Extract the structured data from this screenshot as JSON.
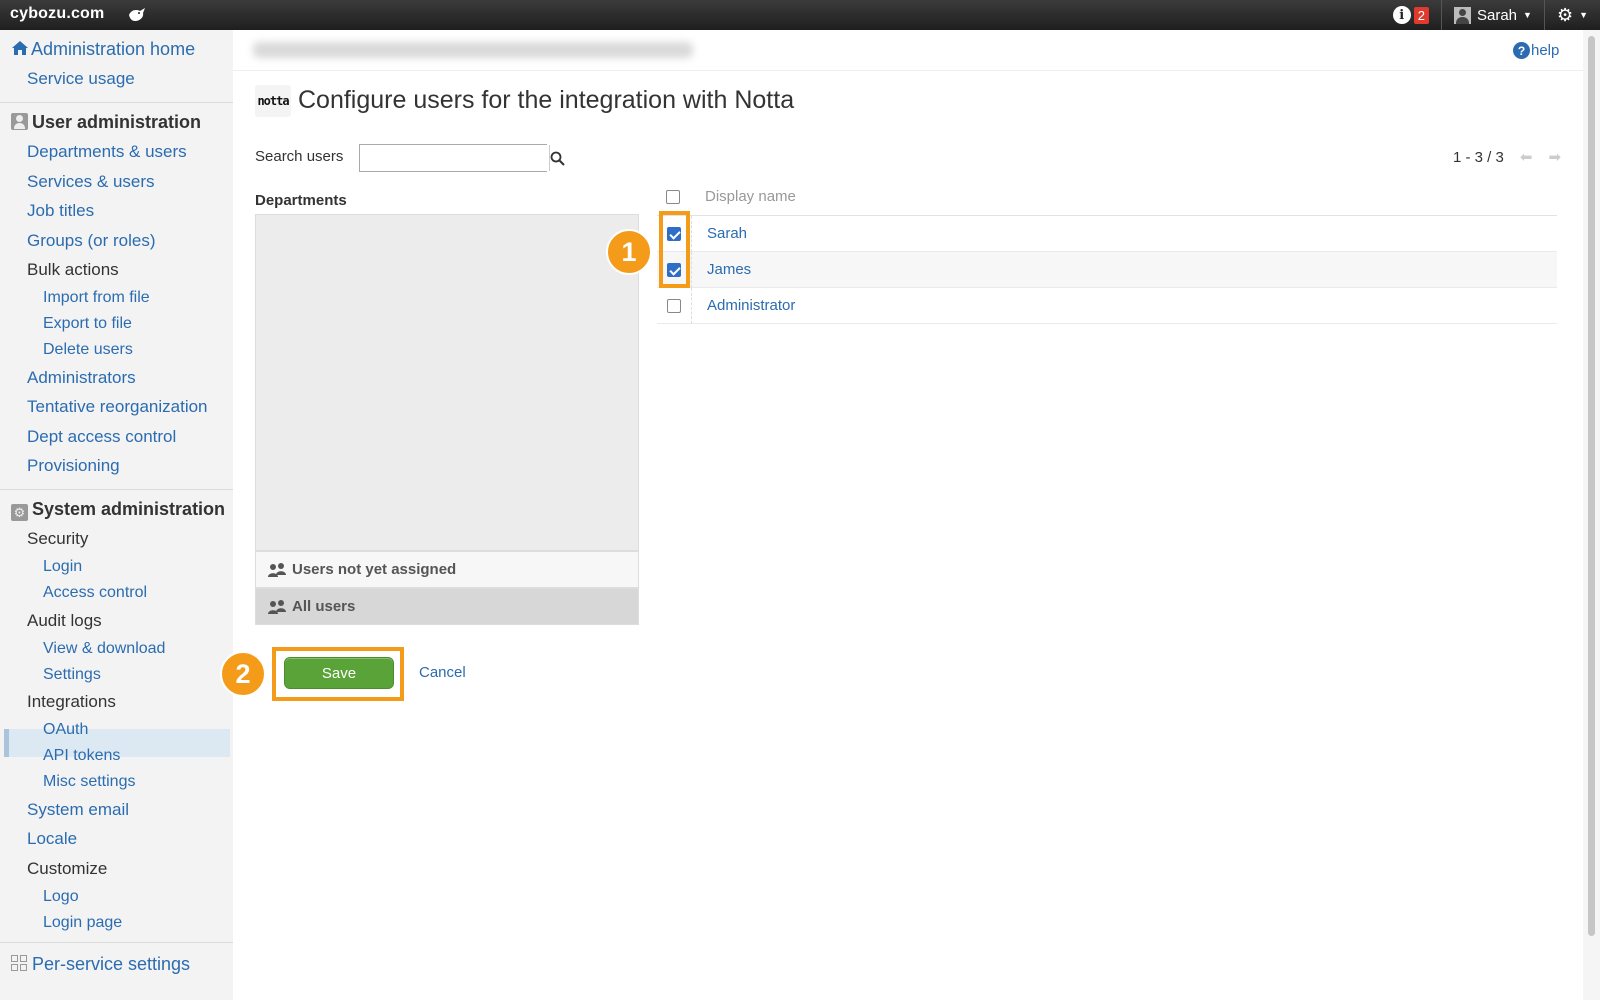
{
  "topbar": {
    "brand": "cybozu.com",
    "notifications_count": "2",
    "user_name": "Sarah"
  },
  "sidebar": {
    "administration_home": "Administration home",
    "service_usage": "Service usage",
    "user_admin": {
      "heading": "User administration",
      "departments_users": "Departments & users",
      "services_users": "Services & users",
      "job_titles": "Job titles",
      "groups_roles": "Groups (or roles)",
      "bulk_actions": "Bulk actions",
      "import_from_file": "Import from file",
      "export_to_file": "Export to file",
      "delete_users": "Delete users",
      "administrators": "Administrators",
      "tentative_reorganization": "Tentative reorganization",
      "dept_access_control": "Dept access control",
      "provisioning": "Provisioning"
    },
    "system_admin": {
      "heading": "System administration",
      "security": "Security",
      "login": "Login",
      "access_control": "Access control",
      "audit_logs": "Audit logs",
      "view_download": "View & download",
      "settings": "Settings",
      "integrations": "Integrations",
      "oauth": "OAuth",
      "api_tokens": "API tokens",
      "misc_settings": "Misc settings",
      "system_email": "System email",
      "locale": "Locale",
      "customize": "Customize",
      "logo": "Logo",
      "login_page": "Login page"
    },
    "per_service_settings": "Per-service settings"
  },
  "main": {
    "help": "help",
    "app_logo_text": "notta",
    "title": "Configure users for the integration with Notta",
    "search_label": "Search users",
    "search_value": "",
    "pager": "1 - 3 / 3",
    "departments_title": "Departments",
    "users_not_assigned": "Users not yet assigned",
    "all_users": "All users",
    "column_display_name": "Display name",
    "users": [
      {
        "name": "Sarah",
        "checked": true
      },
      {
        "name": "James",
        "checked": true
      },
      {
        "name": "Administrator",
        "checked": false
      }
    ],
    "save": "Save",
    "cancel": "Cancel",
    "step1": "1",
    "step2": "2"
  },
  "colors": {
    "highlight": "#f59b1a",
    "save_button": "#5aa339",
    "link": "#2b6cb0"
  }
}
